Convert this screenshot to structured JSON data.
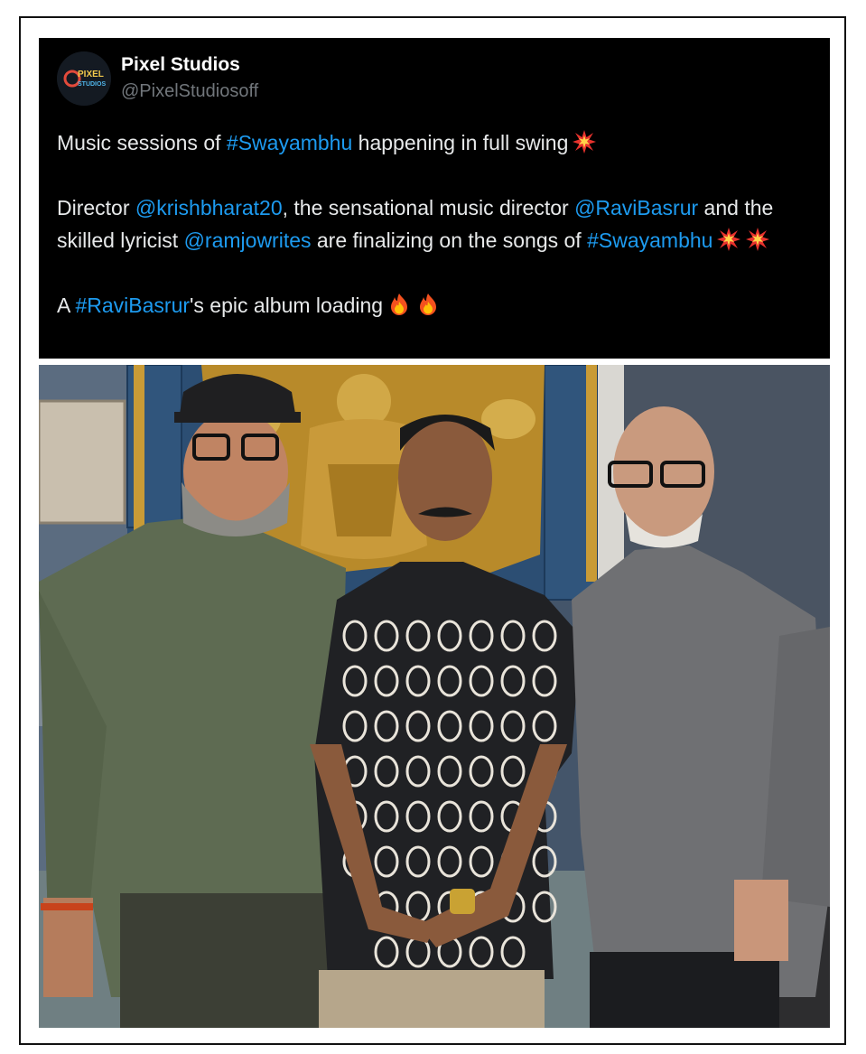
{
  "account": {
    "display_name": "Pixel Studios",
    "handle": "@PixelStudiosoff",
    "avatar_text_top": "PIXEL",
    "avatar_text_bottom": "STUDIOS"
  },
  "tweet": {
    "line1": {
      "pre": "Music sessions of ",
      "tag": "#Swayambhu",
      "post": " happening in full swing",
      "emoji": "collision-emoji"
    },
    "para2": {
      "t1": "Director ",
      "m1": "@krishbharat20",
      "t2": ", the sensational music director ",
      "m2": "@RaviBasrur",
      "t3": " and the skilled lyricist ",
      "m3": "@ramjowrites",
      "t4": " are finalizing on the songs of ",
      "tag": "#Swayambhu",
      "emojis": [
        "collision-emoji",
        "collision-emoji"
      ]
    },
    "line3": {
      "pre": "A ",
      "tag": "#RaviBasrur",
      "post": "'s epic album loading",
      "emojis": [
        "fire-emoji",
        "fire-emoji"
      ]
    }
  },
  "colors": {
    "tweet_bg": "#000000",
    "text": "#e7e9ea",
    "link": "#1d9bf0",
    "handle": "#71767b"
  },
  "photo": {
    "subject": "three-men-standing-in-front-of-golden-deity-relief"
  }
}
